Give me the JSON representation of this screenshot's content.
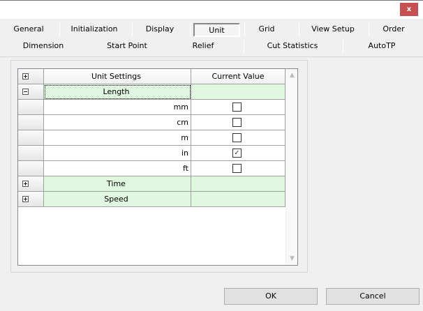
{
  "window": {
    "close_label": "x"
  },
  "tabs_row1": [
    "General",
    "Initialization",
    "Display",
    "Unit",
    "Grid",
    "View Setup",
    "Order"
  ],
  "tabs_row2": [
    "Dimension",
    "Start Point",
    "Relief",
    "Cut Statistics",
    "AutoTP"
  ],
  "active_tab": "Unit",
  "grid": {
    "headers": [
      "Unit Settings",
      "Current Value"
    ],
    "groups": {
      "length": "Length",
      "time": "Time",
      "speed": "Speed"
    },
    "length_items": [
      {
        "label": "mm",
        "checked": false
      },
      {
        "label": "cm",
        "checked": false
      },
      {
        "label": "m",
        "checked": false
      },
      {
        "label": "in",
        "checked": true
      },
      {
        "label": "ft",
        "checked": false
      }
    ]
  },
  "buttons": {
    "ok": "OK",
    "cancel": "Cancel"
  },
  "colors": {
    "group_row": "#dff8df",
    "close": "#c75050"
  }
}
